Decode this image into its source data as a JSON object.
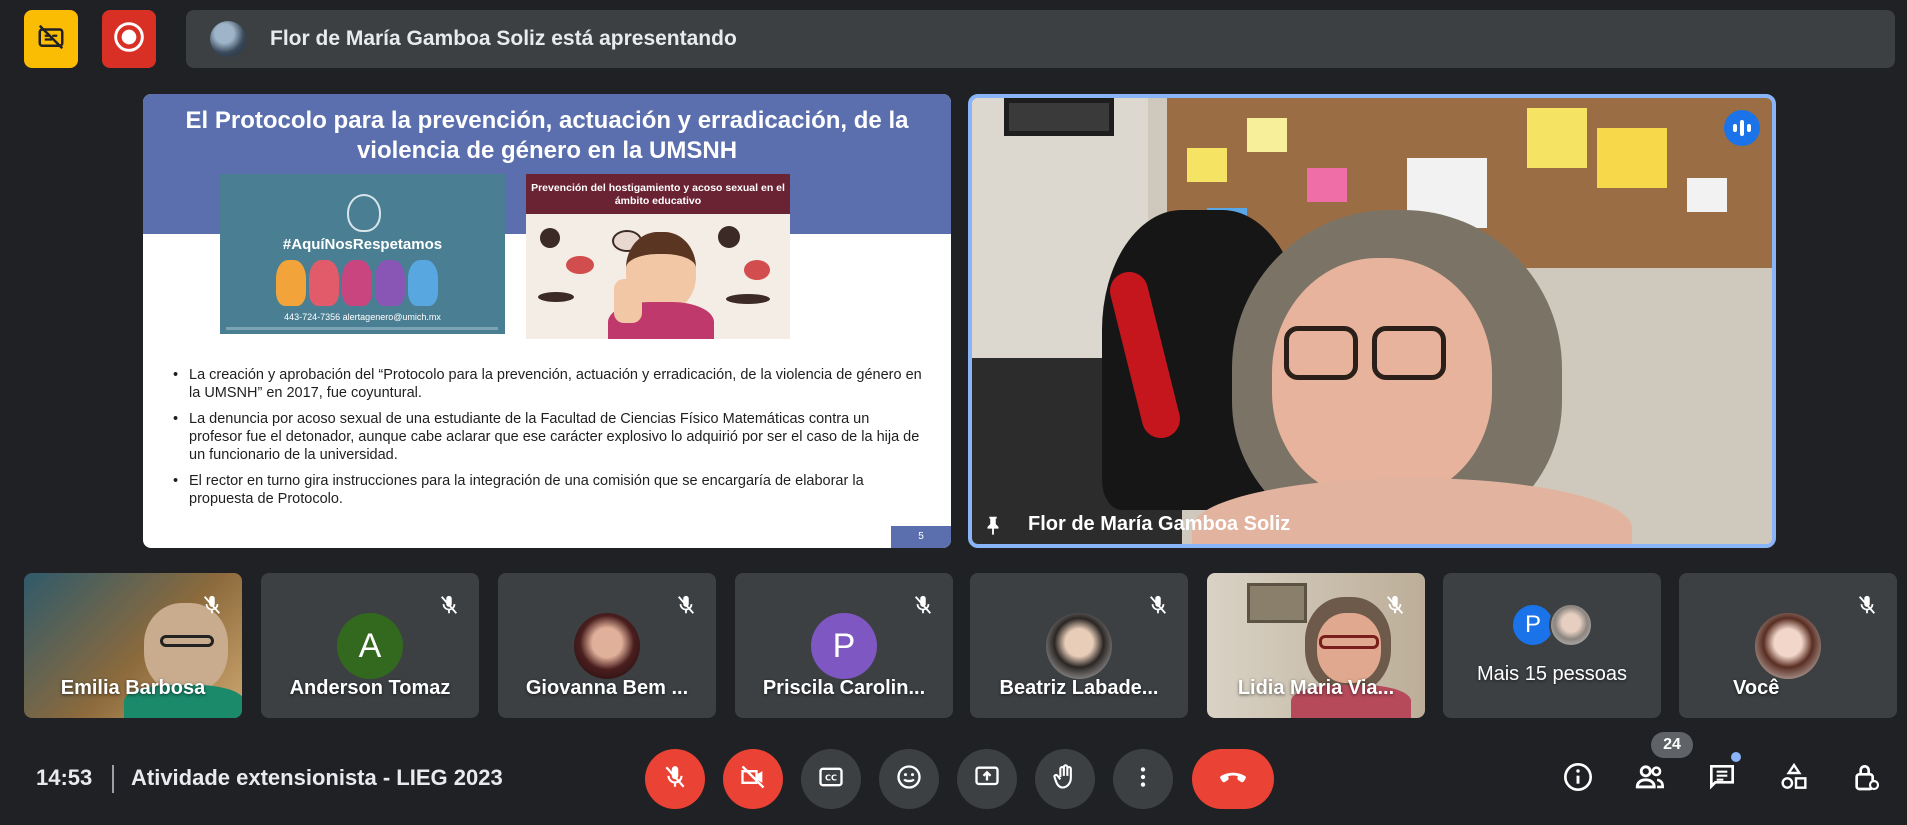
{
  "topbar": {
    "captions_icon": "captions-off-icon",
    "record_icon": "recording-icon",
    "presenting_text": "Flor de María Gamboa Soliz está apresentando"
  },
  "slide": {
    "title": "El Protocolo para la prevención, actuación y erradicación, de la violencia de género en la UMSNH",
    "left_image": {
      "hashtag": "#AquíNosRespetamos",
      "contact": "443-724-7356   alertagenero@umich.mx"
    },
    "right_image": {
      "heading": "Prevención del hostigamiento y acoso sexual en el ámbito educativo"
    },
    "bullets": [
      "La creación y aprobación del “Protocolo para la prevención, actuación y erradicación, de la violencia de género en la UMSNH” en 2017, fue coyuntural.",
      "La denuncia por acoso sexual de una estudiante de la Facultad de Ciencias Físico Matemáticas contra un profesor fue el detonador, aunque cabe aclarar que ese carácter explosivo lo adquirió por ser el caso de la hija de un funcionario de la universidad.",
      "El rector en turno gira instrucciones para la integración de una comisión que se encargaría de elaborar la propuesta de Protocolo."
    ],
    "page_number": "5"
  },
  "main_video": {
    "participant_name": "Flor de María Gamboa Soliz",
    "pin_icon": "pin-icon",
    "speaking_icon": "speaking-indicator-icon"
  },
  "participants": [
    {
      "name": "Emilia Barbosa",
      "avatar": "video",
      "muted": true
    },
    {
      "name": "Anderson Tomaz",
      "avatar": "A",
      "color": "#33691e",
      "muted": true
    },
    {
      "name": "Giovanna Bem ...",
      "avatar": "photo",
      "muted": true
    },
    {
      "name": "Priscila Carolin...",
      "avatar": "P",
      "color": "#7e57c2",
      "muted": true
    },
    {
      "name": "Beatriz Labade...",
      "avatar": "photo",
      "muted": true
    },
    {
      "name": "Lidia Maria Via...",
      "avatar": "video",
      "muted": true
    },
    {
      "name": "Mais 15 pessoas",
      "avatar_letter": "P",
      "avatar_color": "#1a73e8"
    },
    {
      "name": "Você",
      "avatar": "photo",
      "muted": true
    }
  ],
  "bottombar": {
    "time": "14:53",
    "meeting_title": "Atividade extensionista - LIEG 2023",
    "controls": [
      "mic-off-icon",
      "camera-off-icon",
      "captions-icon",
      "emoji-icon",
      "present-screen-icon",
      "raise-hand-icon",
      "more-options-icon",
      "end-call-icon"
    ],
    "right_controls": [
      "info-icon",
      "people-icon",
      "chat-icon",
      "activities-icon",
      "host-controls-icon"
    ],
    "people_count": "24"
  },
  "colors": {
    "background": "#202124",
    "surface": "#3c4043",
    "danger": "#ea4335",
    "accent_blue": "#8ab4f8",
    "captions_yellow": "#fbbc04"
  }
}
